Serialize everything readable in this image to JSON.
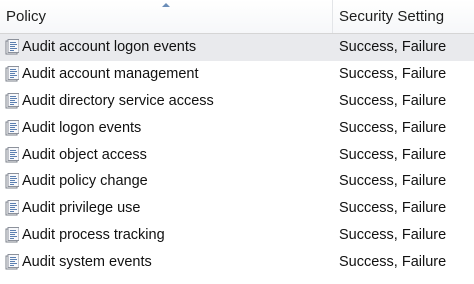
{
  "header": {
    "policy": "Policy",
    "setting": "Security Setting"
  },
  "icon": "policy-document-icon",
  "rows": [
    {
      "policy": "Audit account logon events",
      "setting": "Success, Failure",
      "selected": true
    },
    {
      "policy": "Audit account management",
      "setting": "Success, Failure"
    },
    {
      "policy": "Audit directory service access",
      "setting": "Success, Failure"
    },
    {
      "policy": "Audit logon events",
      "setting": "Success, Failure"
    },
    {
      "policy": "Audit object access",
      "setting": "Success, Failure"
    },
    {
      "policy": "Audit policy change",
      "setting": "Success, Failure"
    },
    {
      "policy": "Audit privilege use",
      "setting": "Success, Failure"
    },
    {
      "policy": "Audit process tracking",
      "setting": "Success, Failure"
    },
    {
      "policy": "Audit system events",
      "setting": "Success, Failure"
    }
  ]
}
